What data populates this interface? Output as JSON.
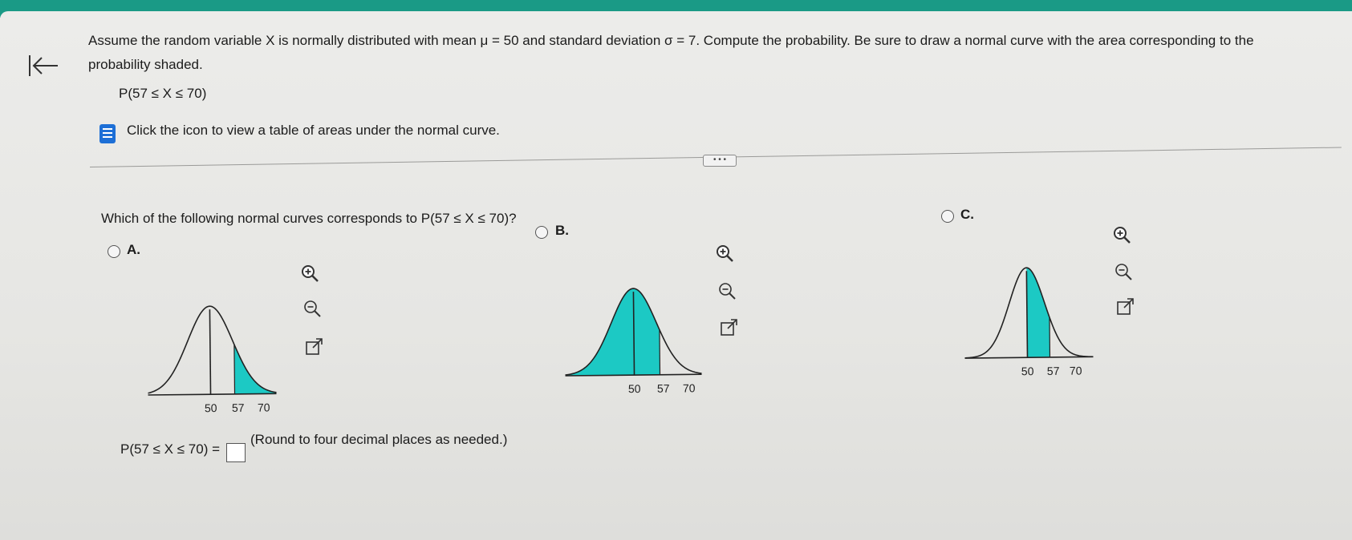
{
  "question": {
    "line1": "Assume the random variable X is normally distributed with mean μ = 50 and standard deviation σ = 7. Compute the probability. Be sure to draw a normal curve with the area corresponding to the",
    "line2": "probability shaded.",
    "expression": "P(57 ≤ X ≤ 70)"
  },
  "table_link": {
    "label": "Click the icon to view a table of areas under the normal curve."
  },
  "more_label": "• • •",
  "prompt": "Which of the following normal curves corresponds to P(57 ≤ X ≤ 70)?",
  "options": [
    {
      "label": "A.",
      "ticks": [
        "50",
        "57",
        "70"
      ]
    },
    {
      "label": "B.",
      "ticks": [
        "50",
        "57",
        "70"
      ]
    },
    {
      "label": "C.",
      "ticks": [
        "50",
        "57",
        "70"
      ]
    }
  ],
  "answer": {
    "label": "P(57 ≤ X ≤ 70) =",
    "value": "",
    "hint": "(Round to four decimal places as needed.)"
  },
  "colors": {
    "shade": "#1cc9c4",
    "header": "#1a9a86",
    "book_icon": "#1d6fd6"
  },
  "icons": [
    "back-to-start-icon",
    "table-book-icon",
    "zoom-in-icon",
    "zoom-out-icon",
    "open-new-window-icon"
  ]
}
